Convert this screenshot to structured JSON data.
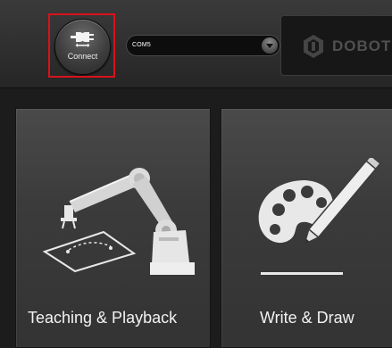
{
  "toolbar": {
    "connect_label": "Connect",
    "port": {
      "selected": "COM5"
    },
    "brand": {
      "text": "DOBOT"
    },
    "highlight_color": "#d8121b"
  },
  "modes": [
    {
      "label": "Teaching & Playback",
      "icon": "robot-arm-icon"
    },
    {
      "label": "Write & Draw",
      "icon": "palette-pencil-icon"
    }
  ]
}
